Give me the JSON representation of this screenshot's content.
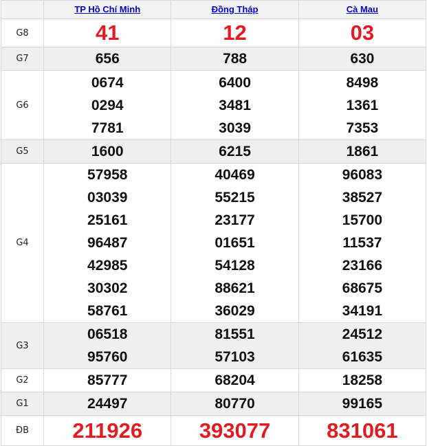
{
  "provinces": [
    "TP Hồ Chí Minh",
    "Đồng Tháp",
    "Cà Mau"
  ],
  "rows": {
    "g8": {
      "label": "G8",
      "values": [
        [
          "41"
        ],
        [
          "12"
        ],
        [
          "03"
        ]
      ]
    },
    "g7": {
      "label": "G7",
      "values": [
        [
          "656"
        ],
        [
          "788"
        ],
        [
          "630"
        ]
      ]
    },
    "g6": {
      "label": "G6",
      "values": [
        [
          "0674",
          "0294",
          "7781"
        ],
        [
          "6400",
          "3481",
          "3039"
        ],
        [
          "8498",
          "1361",
          "7353"
        ]
      ]
    },
    "g5": {
      "label": "G5",
      "values": [
        [
          "1600"
        ],
        [
          "6215"
        ],
        [
          "1861"
        ]
      ]
    },
    "g4": {
      "label": "G4",
      "values": [
        [
          "57958",
          "03039",
          "25161",
          "96487",
          "42985",
          "30302",
          "58761"
        ],
        [
          "40469",
          "55215",
          "23177",
          "01651",
          "54128",
          "88621",
          "36029"
        ],
        [
          "96083",
          "38527",
          "15700",
          "11537",
          "23166",
          "68675",
          "34191"
        ]
      ]
    },
    "g3": {
      "label": "G3",
      "values": [
        [
          "06518",
          "95760"
        ],
        [
          "81551",
          "57103"
        ],
        [
          "24512",
          "61635"
        ]
      ]
    },
    "g2": {
      "label": "G2",
      "values": [
        [
          "85777"
        ],
        [
          "68204"
        ],
        [
          "18258"
        ]
      ]
    },
    "g1": {
      "label": "G1",
      "values": [
        [
          "24497"
        ],
        [
          "80770"
        ],
        [
          "99165"
        ]
      ]
    },
    "db": {
      "label": "ĐB",
      "values": [
        [
          "211926"
        ],
        [
          "393077"
        ],
        [
          "831061"
        ]
      ]
    }
  },
  "colors": {
    "jackpot": "#e01b23",
    "link": "#0000cc",
    "shade": "#efefef"
  }
}
